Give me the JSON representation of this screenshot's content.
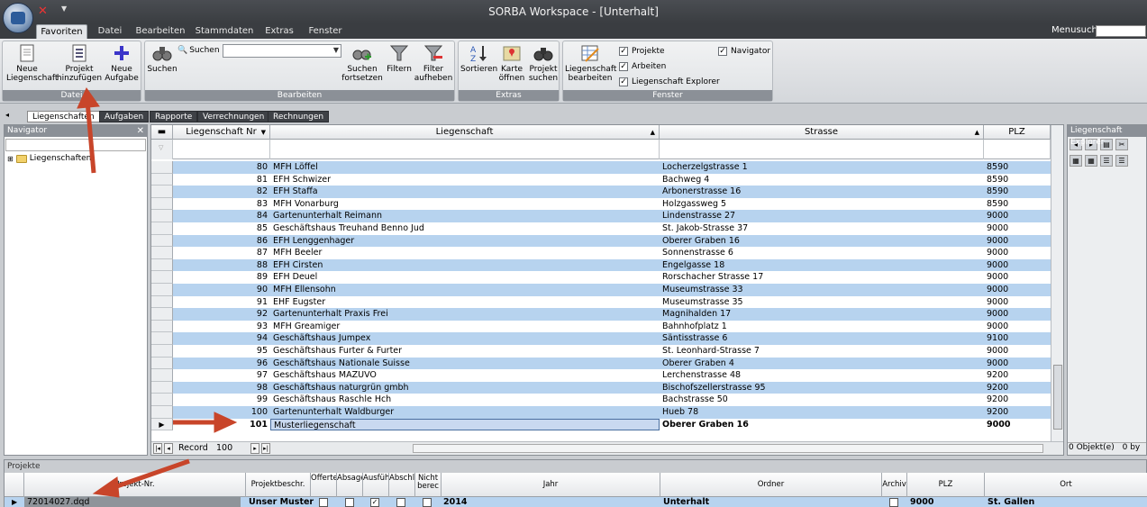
{
  "window": {
    "title": "SORBA Workspace - [Unterhalt]"
  },
  "ribbon_tabs": [
    "Favoriten",
    "Datei",
    "Bearbeiten",
    "Stammdaten",
    "Extras",
    "Fenster"
  ],
  "menusuche_label": "Menusuche",
  "groups": {
    "datei": {
      "label": "Datei",
      "buttons": [
        "Neue Liegenschaft",
        "Projekt hinzufügen",
        "Neue Aufgabe"
      ]
    },
    "bearbeiten": {
      "label": "Bearbeiten",
      "search_label": "Suchen",
      "buttons": [
        "Suchen",
        "Suchen fortsetzen",
        "Filtern",
        "Filter aufheben"
      ]
    },
    "extras": {
      "label": "Extras",
      "buttons": [
        "Sortieren",
        "Karte öffnen",
        "Projekt suchen"
      ]
    },
    "fenster": {
      "label": "Fenster",
      "button": "Liegenschaft bearbeiten",
      "checks": [
        "Projekte",
        "Arbeiten",
        "Liegenschaft Explorer",
        "Navigator"
      ]
    }
  },
  "doc_tabs": [
    "Liegenschaften",
    "Aufgaben",
    "Rapporte",
    "Verrechnungen",
    "Rechnungen"
  ],
  "navigator": {
    "title": "Navigator",
    "tree_item": "Liegenschaften"
  },
  "grid": {
    "columns": [
      "Liegenschaft Nr",
      "Liegenschaft",
      "Strasse",
      "PLZ"
    ],
    "rows": [
      [
        "80",
        "MFH Löffel",
        "Locherzelgstrasse 1",
        "8590"
      ],
      [
        "81",
        "EFH Schwizer",
        "Bachweg 4",
        "8590"
      ],
      [
        "82",
        "EFH Staffa",
        "Arbonerstrasse 16",
        "8590"
      ],
      [
        "83",
        "MFH Vonarburg",
        "Holzgassweg 5",
        "8590"
      ],
      [
        "84",
        "Gartenunterhalt Reimann",
        "Lindenstrasse 27",
        "9000"
      ],
      [
        "85",
        "Geschäftshaus Treuhand Benno Jud",
        "St. Jakob-Strasse 37",
        "9000"
      ],
      [
        "86",
        "EFH Lenggenhager",
        "Oberer Graben 16",
        "9000"
      ],
      [
        "87",
        "MFH Beeler",
        "Sonnenstrasse 6",
        "9000"
      ],
      [
        "88",
        "EFH Cirsten",
        "Engelgasse 18",
        "9000"
      ],
      [
        "89",
        "EFH Deuel",
        "Rorschacher Strasse 17",
        "9000"
      ],
      [
        "90",
        "MFH Ellensohn",
        "Museumstrasse 33",
        "9000"
      ],
      [
        "91",
        "EHF Eugster",
        "Museumstrasse 35",
        "9000"
      ],
      [
        "92",
        "Gartenunterhalt Praxis Frei",
        "Magnihalden 17",
        "9000"
      ],
      [
        "93",
        "MFH Greamiger",
        "Bahnhofplatz 1",
        "9000"
      ],
      [
        "94",
        "Geschäftshaus Jumpex",
        "Säntisstrasse 6",
        "9100"
      ],
      [
        "95",
        "Geschäftshaus Furter & Furter",
        "St. Leonhard-Strasse 7",
        "9000"
      ],
      [
        "96",
        "Geschäftshaus Nationale Suisse",
        "Oberer Graben 4",
        "9000"
      ],
      [
        "97",
        "Geschäftshaus MAZUVO",
        "Lerchenstrasse 48",
        "9200"
      ],
      [
        "98",
        "Geschäftshaus naturgrün gmbh",
        "Bischofszellerstrasse 95",
        "9200"
      ],
      [
        "99",
        "Geschäftshaus Raschle Hch",
        "Bachstrasse 50",
        "9200"
      ],
      [
        "100",
        "Gartenunterhalt Waldburger",
        "Hueb 78",
        "9200"
      ],
      [
        "101",
        "Musterliegenschaft",
        "Oberer Graben 16",
        "9000"
      ]
    ],
    "record_label": "Record",
    "record_value": "100"
  },
  "explorer": {
    "title": "Liegenschaft Explorer",
    "footer": "0 Objekt(e)",
    "footer2": "0 by"
  },
  "projekte": {
    "title": "Projekte",
    "columns": [
      "Projekt-Nr.",
      "Projektbeschr.",
      "Offerte",
      "Absage",
      "Ausführung",
      "Abschluss",
      "Nicht berec",
      "Jahr",
      "Ordner",
      "Archiv",
      "PLZ",
      "Ort"
    ],
    "row": {
      "nr": "72014027.dqd",
      "beschr": "Unser Muster",
      "jahr": "2014",
      "ordner": "Unterhalt",
      "plz": "9000",
      "ort": "St. Gallen"
    }
  },
  "colors": {
    "row_alt": "#b7d3ef",
    "arrow": "#c8452a",
    "titlebar": "#3a3d41"
  }
}
